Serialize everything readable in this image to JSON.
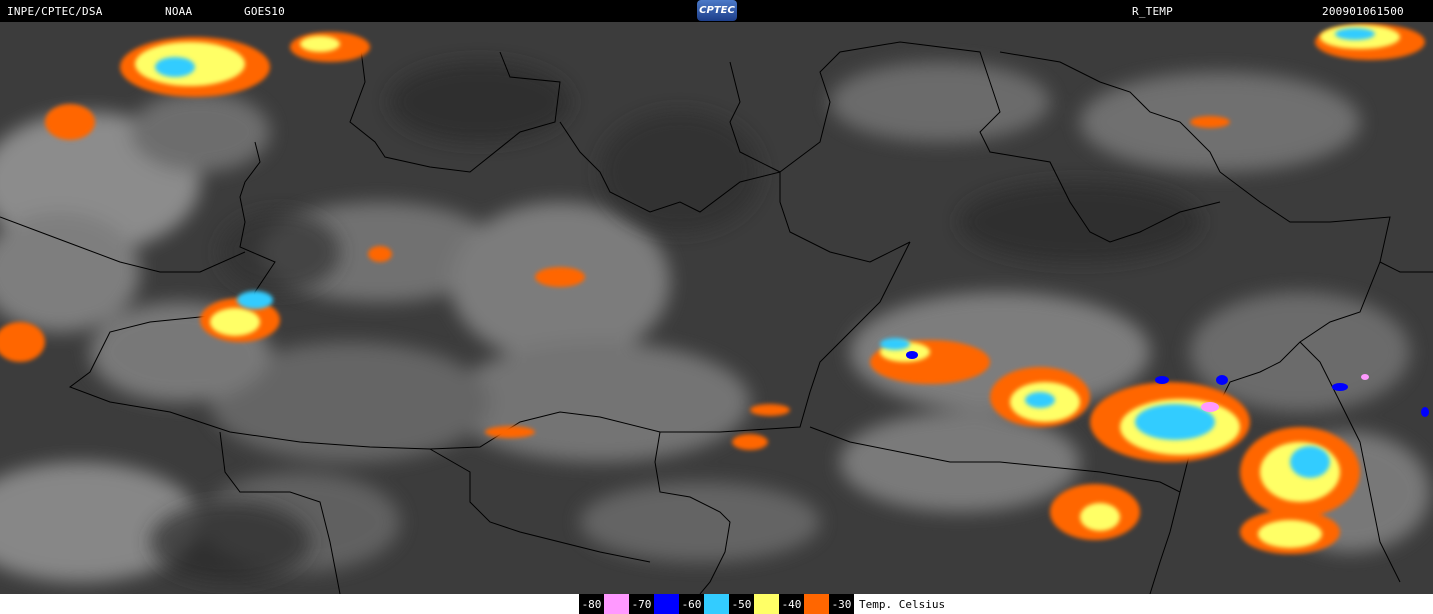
{
  "header": {
    "source": "INPE/CPTEC/DSA",
    "agency": "NOAA",
    "satellite": "GOES10",
    "logo_text": "CPTEC",
    "product": "R_TEMP",
    "timestamp": "200901061500"
  },
  "legend": {
    "unit_label": "Temp. Celsius",
    "items": [
      {
        "label": "-80",
        "color": "#ff99ff"
      },
      {
        "label": "-70",
        "color": "#0000ff"
      },
      {
        "label": "-60",
        "color": "#33ccff"
      },
      {
        "label": "-50",
        "color": "#ffff66"
      },
      {
        "label": "-40",
        "color": "#ff6600"
      },
      {
        "label": "-30",
        "color": "#000000"
      }
    ]
  },
  "colors": {
    "background": "#000000",
    "map_dark": "#3c3c3c",
    "cloud_gray": "#9a9a9a",
    "border_line": "#000000"
  }
}
